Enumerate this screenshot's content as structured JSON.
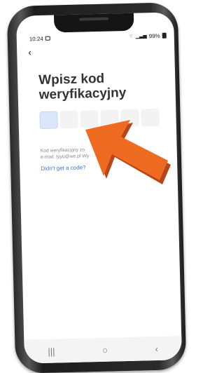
{
  "status_bar": {
    "time": "10:24",
    "right_text": "99%"
  },
  "page": {
    "title": "Wpisz kod weryfikacyjny",
    "code_length": 6,
    "info_line1": "Kod weryfikacyjny zo",
    "info_line1_end": "ss",
    "info_line2": "e-mail: tyyu@we.pl Wy",
    "resend_link": "Didn't get a code?"
  },
  "nav": {
    "recents": "|||",
    "home": "○",
    "back": "‹"
  },
  "colors": {
    "arrow": "#ef6b22",
    "link": "#3b74d6"
  }
}
